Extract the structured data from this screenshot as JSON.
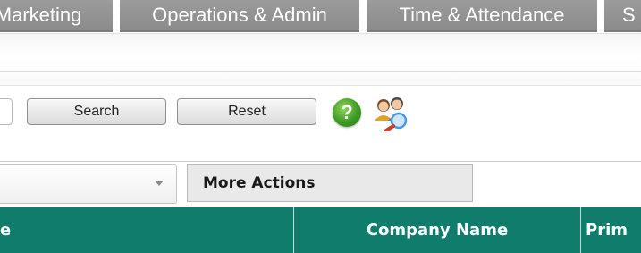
{
  "nav": {
    "tabs": [
      {
        "label": "Marketing"
      },
      {
        "label": "Operations & Admin"
      },
      {
        "label": "Time & Attendance"
      },
      {
        "label": "S"
      }
    ]
  },
  "search": {
    "search_label": "Search",
    "reset_label": "Reset",
    "help_icon_glyph": "?"
  },
  "actions": {
    "select_value": "",
    "more_actions_label": "More Actions"
  },
  "table": {
    "columns": [
      {
        "label": "e"
      },
      {
        "label": "Company Name"
      },
      {
        "label": "Prim"
      }
    ]
  },
  "colors": {
    "header_bg": "#0f7c6c",
    "tab_bg": "#8e8e8e",
    "help_icon": "#3d9b22"
  },
  "icons": [
    "help-icon",
    "people-search-icon",
    "chevron-down-icon"
  ]
}
